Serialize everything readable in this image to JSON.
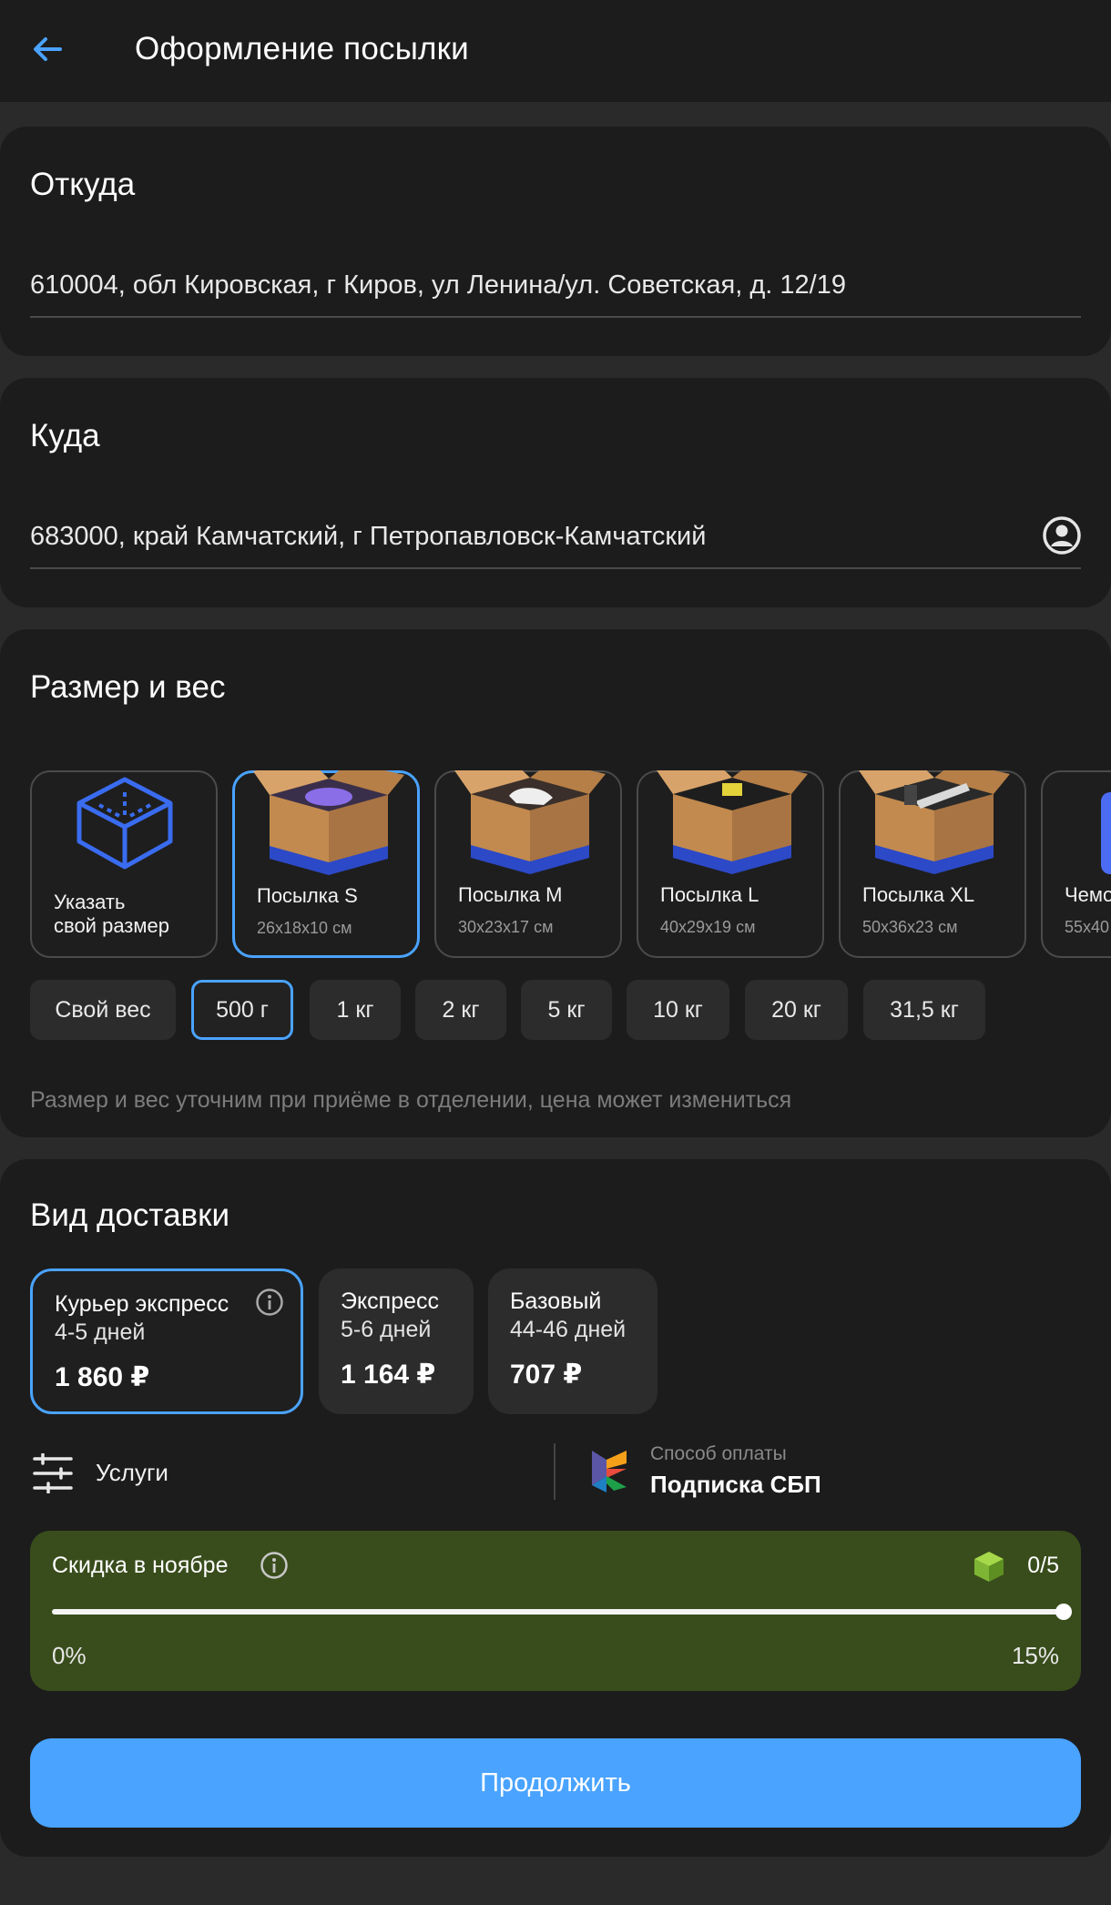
{
  "header": {
    "title": "Оформление посылки"
  },
  "from": {
    "title": "Откуда",
    "address": "610004, обл Кировская, г Киров, ул Ленина/ул. Советская, д. 12/19"
  },
  "to": {
    "title": "Куда",
    "address": "683000, край Камчатский, г Петропавловск-Камчатский"
  },
  "size": {
    "title": "Размер и вес",
    "custom_label": "Указать свой размер",
    "packages": [
      {
        "name": "Посылка S",
        "dims": "26x18x10 см",
        "selected": true
      },
      {
        "name": "Посылка M",
        "dims": "30x23x17 см",
        "selected": false
      },
      {
        "name": "Посылка L",
        "dims": "40x29x19 см",
        "selected": false
      },
      {
        "name": "Посылка XL",
        "dims": "50x36x23 см",
        "selected": false
      },
      {
        "name": "Чемо",
        "dims": "55x40",
        "selected": false
      }
    ],
    "weights": [
      "Свой вес",
      "500 г",
      "1 кг",
      "2 кг",
      "5 кг",
      "10 кг",
      "20 кг",
      "31,5 кг"
    ],
    "selected_weight": "500 г",
    "hint": "Размер и вес уточним при приёме в отделении, цена может измениться"
  },
  "delivery": {
    "title": "Вид доставки",
    "options": [
      {
        "name": "Курьер экспресс",
        "days": "4-5 дней",
        "price": "1 860 ₽",
        "selected": true
      },
      {
        "name": "Экспресс",
        "days": "5-6 дней",
        "price": "1 164 ₽",
        "selected": false
      },
      {
        "name": "Базовый",
        "days": "44-46 дней",
        "price": "707 ₽",
        "selected": false
      }
    ],
    "services_label": "Услуги",
    "payment_caption": "Способ оплаты",
    "payment_value": "Подписка СБП"
  },
  "promo": {
    "title": "Скидка в ноябре",
    "count": "0/5",
    "min_label": "0%",
    "max_label": "15%",
    "progress": 1.0
  },
  "actions": {
    "continue_label": "Продолжить"
  },
  "colors": {
    "accent": "#4aa3ff",
    "card_bg": "#1c1c1c",
    "promo_bg": "#394d1c"
  }
}
